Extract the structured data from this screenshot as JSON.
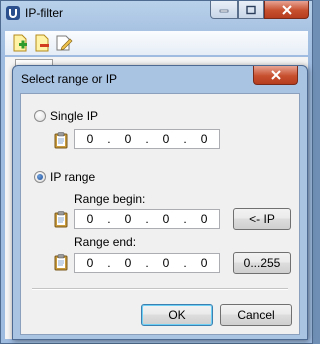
{
  "window": {
    "title": "IP-filter"
  },
  "toolbar": {
    "buttons": [
      {
        "icon": "add-icon"
      },
      {
        "icon": "remove-icon"
      },
      {
        "icon": "edit-icon"
      }
    ]
  },
  "dialog": {
    "title": "Select range or IP",
    "single_ip": {
      "label": "Single IP",
      "checked": false,
      "ip": [
        "0",
        "0",
        "0",
        "0"
      ]
    },
    "ip_range": {
      "label": "IP range",
      "checked": true,
      "range_begin_label": "Range begin:",
      "range_begin": [
        "0",
        "0",
        "0",
        "0"
      ],
      "copy_button_label": "<- IP",
      "range_end_label": "Range end:",
      "range_end": [
        "0",
        "0",
        "0",
        "0"
      ],
      "max_button_label": "0...255"
    },
    "ok_label": "OK",
    "cancel_label": "Cancel"
  },
  "colors": {
    "accent": "#1d4f9a",
    "close_button": "#c7502f"
  }
}
